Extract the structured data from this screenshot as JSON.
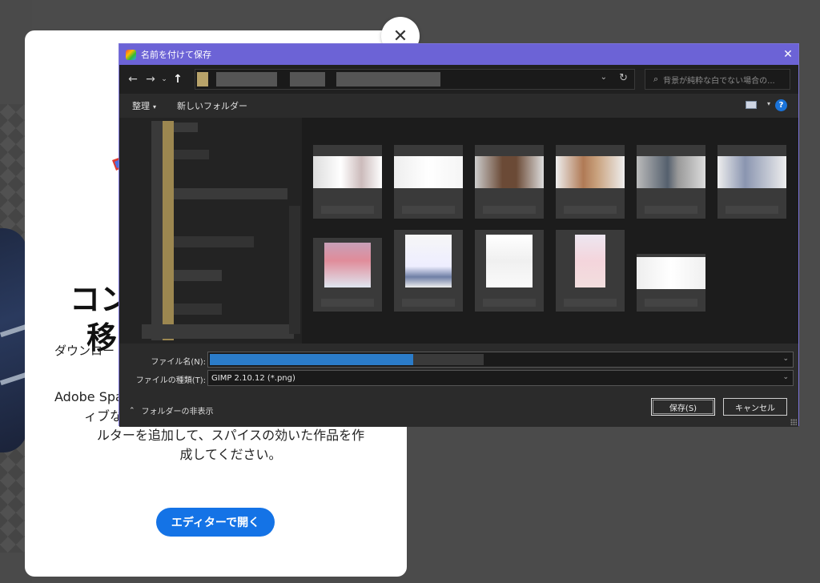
{
  "background_page": {
    "close_glyph": "✕",
    "title_line1": "コン",
    "title_line2": "移",
    "subtitle": "ダウンロー",
    "body_line1": "Adobe Spa",
    "body_line2": "ィブなセ",
    "body_line3": "ルターを追加して、スパイスの効いた作品を作",
    "body_line4": "成してください。",
    "open_editor_button": "エディターで開く",
    "accent_color": "#1473e6"
  },
  "dialog": {
    "title": "名前を付けて保存",
    "close_glyph": "✕",
    "nav": {
      "back": "←",
      "forward": "→",
      "recent": "⌄",
      "up": "↑",
      "address_dropdown": "⌄",
      "refresh": "↻"
    },
    "search_placeholder": "背景が純粋な白でない場合の...",
    "search_icon": "⌕",
    "toolbar": {
      "organize": "整理",
      "organize_chevron": "▾",
      "new_folder": "新しいフォルダー",
      "view_chevron": "▾",
      "help": "?"
    },
    "filename_label": "ファイル名(N):",
    "filetype_label": "ファイルの種類(T):",
    "filetype_value": "GIMP 2.10.12 (*.png)",
    "field_dropdown": "⌄",
    "hide_folders": "フォルダーの非表示",
    "hide_folders_chevron": "⌃",
    "save_button": "保存(S)",
    "cancel_button": "キャンセル",
    "title_bar_color": "#6c63d6"
  }
}
